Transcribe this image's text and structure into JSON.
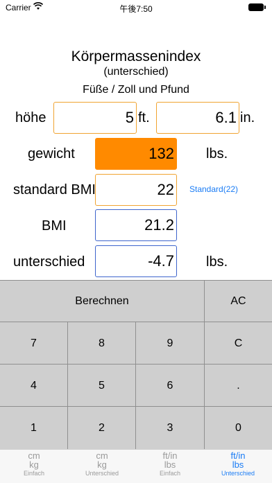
{
  "status": {
    "carrier": "Carrier",
    "time": "午後7:50"
  },
  "title": {
    "main": "Körpermassenindex",
    "sub": "(unterschied)",
    "units": "Füße / Zoll und Pfund"
  },
  "rows": {
    "height": {
      "label": "höhe",
      "feet": "5",
      "feet_unit": "ft.",
      "inches": "6.1",
      "inches_unit": "in."
    },
    "weight": {
      "label": "gewicht",
      "value": "132",
      "unit": "lbs."
    },
    "standard_bmi": {
      "label": "standard BMI",
      "value": "22",
      "link": "Standard(22)"
    },
    "bmi": {
      "label": "BMI",
      "value": "21.2"
    },
    "difference": {
      "label": "unterschied",
      "value": "-4.7",
      "unit": "lbs."
    }
  },
  "keypad": {
    "calculate": "Berechnen",
    "ac": "AC",
    "keys": [
      "7",
      "8",
      "9",
      "C",
      "4",
      "5",
      "6",
      ".",
      "1",
      "2",
      "3",
      "0"
    ]
  },
  "tabs": [
    {
      "l1": "cm",
      "l2": "kg",
      "l3": "Einfach"
    },
    {
      "l1": "cm",
      "l2": "kg",
      "l3": "Unterschied"
    },
    {
      "l1": "ft/in",
      "l2": "lbs",
      "l3": "Einfach"
    },
    {
      "l1": "ft/in",
      "l2": "lbs",
      "l3": "Unterschied"
    }
  ],
  "colors": {
    "accent": "#1a7cf5",
    "orange": "#ff8a00",
    "border_orange": "#f0a330",
    "border_blue": "#3d64cc"
  }
}
